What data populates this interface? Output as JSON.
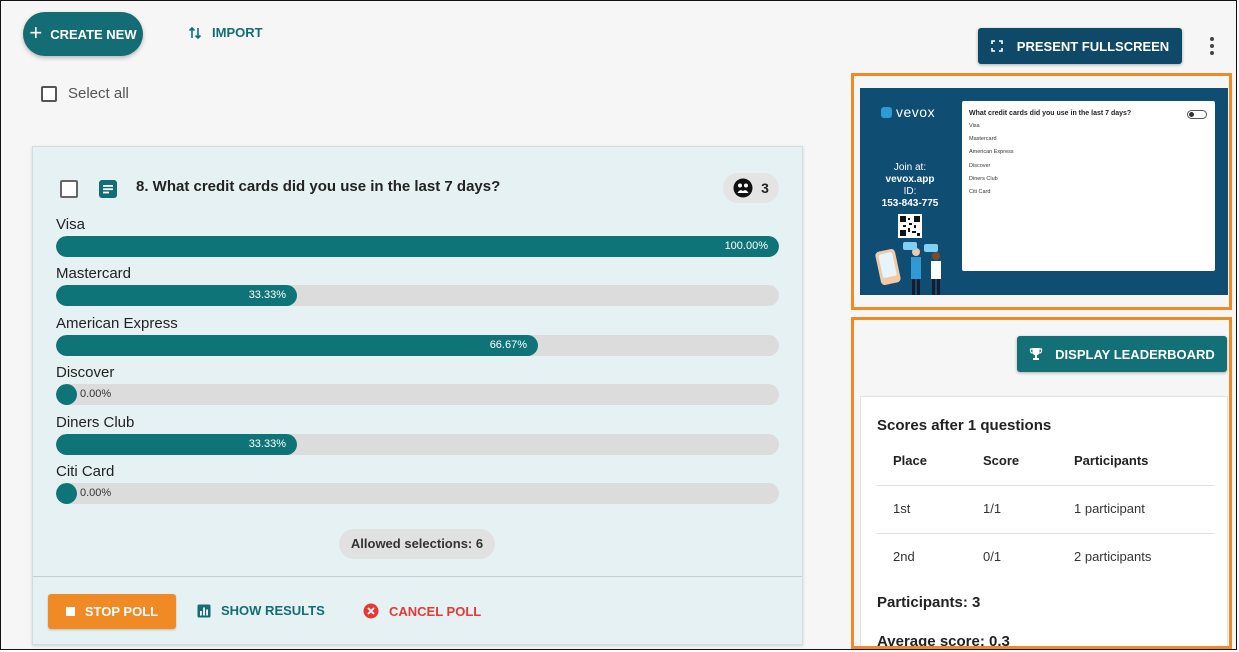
{
  "toolbar": {
    "create_new_label": "CREATE NEW",
    "import_label": "IMPORT",
    "select_all_label": "Select all",
    "present_fullscreen_label": "PRESENT FULLSCREEN"
  },
  "question": {
    "title": "8. What credit cards did you use in the last 7 days?",
    "response_count": "3",
    "options": [
      {
        "label": "Visa",
        "percent": 100,
        "percent_text": "100.00%"
      },
      {
        "label": "Mastercard",
        "percent": 33.33,
        "percent_text": "33.33%"
      },
      {
        "label": "American Express",
        "percent": 66.67,
        "percent_text": "66.67%"
      },
      {
        "label": "Discover",
        "percent": 0,
        "percent_text": "0.00%"
      },
      {
        "label": "Diners Club",
        "percent": 33.33,
        "percent_text": "33.33%"
      },
      {
        "label": "Citi Card",
        "percent": 0,
        "percent_text": "0.00%"
      }
    ],
    "allowed_selections": "Allowed selections: 6",
    "stop_poll_label": "STOP POLL",
    "show_results_label": "SHOW RESULTS",
    "cancel_poll_label": "CANCEL POLL"
  },
  "preview": {
    "logo_text": "vevox",
    "join_label": "Join at:",
    "join_url": "vevox.app",
    "id_label": "ID:",
    "session_id": "153-843-775",
    "question": "What credit cards did you use in the last 7 days?",
    "options": [
      "Visa",
      "Mastercard",
      "American Express",
      "Discover",
      "Diners Club",
      "Citi Card"
    ]
  },
  "leaderboard": {
    "display_label": "DISPLAY LEADERBOARD",
    "heading": "Scores after 1 questions",
    "columns": [
      "Place",
      "Score",
      "Participants"
    ],
    "rows": [
      {
        "place": "1st",
        "score": "1/1",
        "participants": "1 participant"
      },
      {
        "place": "2nd",
        "score": "0/1",
        "participants": "2 participants"
      }
    ],
    "participants_summary": "Participants: 3",
    "average_score": "Average score: 0.3"
  },
  "colors": {
    "teal": "#146c74",
    "bar_fill": "#0f7478",
    "navy": "#0e4a67",
    "orange": "#f08a24",
    "red": "#e53935"
  }
}
